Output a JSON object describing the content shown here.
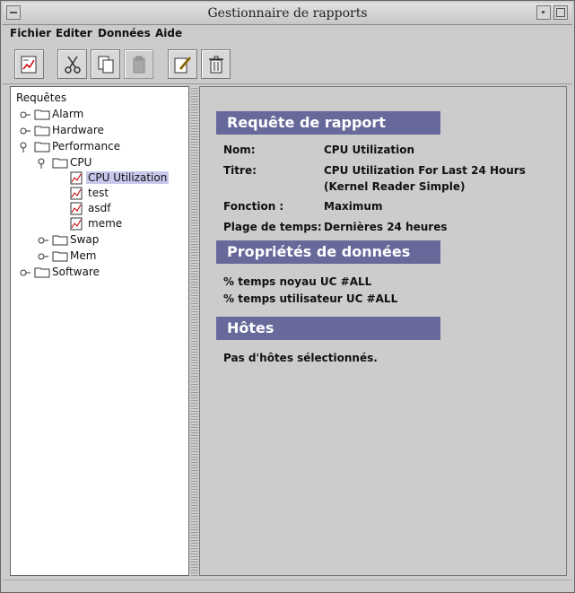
{
  "window": {
    "title": "Gestionnaire de rapports"
  },
  "menubar": {
    "items": [
      "Fichier",
      "Editer",
      "Données",
      "Aide"
    ]
  },
  "toolbar": {
    "buttons": [
      "report-icon",
      "cut-icon",
      "copy-icon",
      "paste-icon",
      "edit-icon",
      "trash-icon"
    ]
  },
  "tree": {
    "root": "Requêtes",
    "items": [
      {
        "label": "Alarm"
      },
      {
        "label": "Hardware"
      },
      {
        "label": "Performance"
      },
      {
        "label": "CPU"
      },
      {
        "label": "CPU Utilization"
      },
      {
        "label": "test"
      },
      {
        "label": "asdf"
      },
      {
        "label": "meme"
      },
      {
        "label": "Swap"
      },
      {
        "label": "Mem"
      },
      {
        "label": "Software"
      }
    ]
  },
  "details": {
    "request_header": "Requête de rapport",
    "fields": [
      {
        "key": "Nom:",
        "value": "CPU Utilization"
      },
      {
        "key": "Titre:",
        "value": "CPU Utilization For Last 24 Hours (Kernel Reader Simple)"
      },
      {
        "key": "Fonction :",
        "value": "Maximum"
      },
      {
        "key": "Plage de temps:",
        "value": "Dernières 24 heures"
      }
    ],
    "data_header": "Propriétés de données",
    "data_props": [
      "% temps noyau UC #ALL",
      "% temps utilisateur UC #ALL"
    ],
    "hosts_header": "Hôtes",
    "hosts_text": "Pas d'hôtes sélectionnés."
  },
  "colors": {
    "header_bg": "#66699a",
    "selected_bg": "#c8c8ec"
  }
}
